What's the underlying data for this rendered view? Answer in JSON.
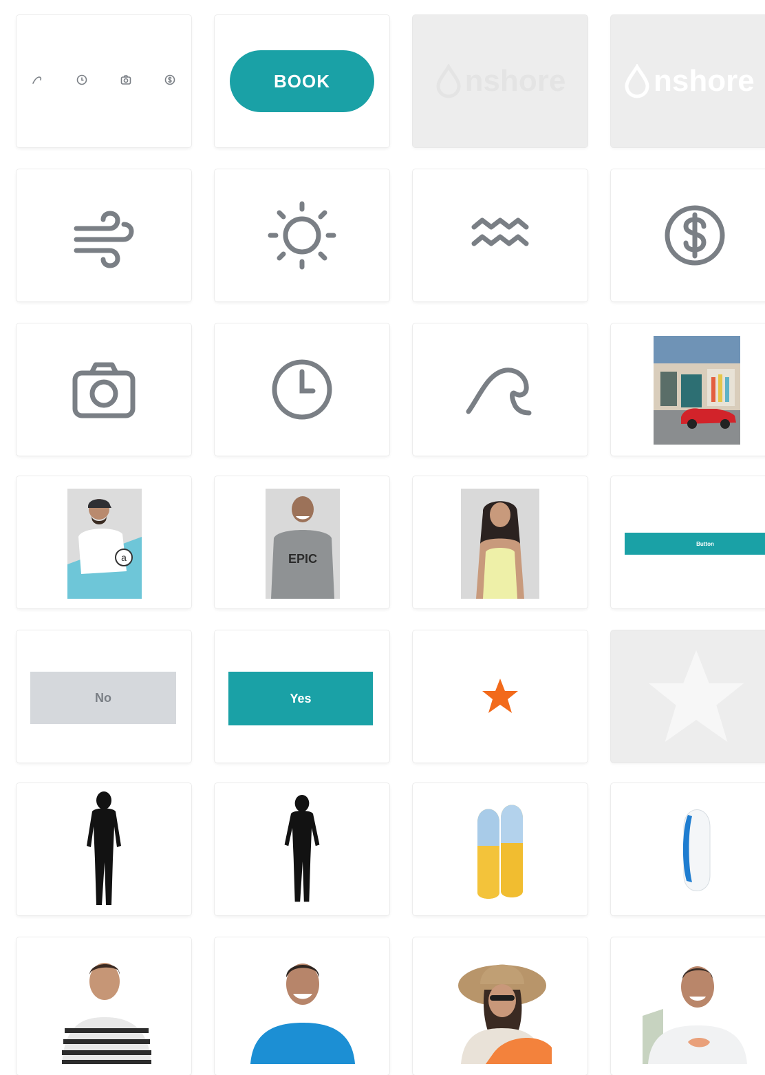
{
  "colors": {
    "brand_teal": "#1aa1a6",
    "icon_grey": "#7a7f85",
    "star_orange": "#f26a1b",
    "disabled_grey": "#d5d8dc"
  },
  "row1": {
    "mini_icons": [
      "wave-icon",
      "clock-icon",
      "camera-icon",
      "dollar-icon"
    ],
    "book_button": "BOOK",
    "logo_faded": "nshore",
    "logo_white": "nshore"
  },
  "row2": {
    "icons": [
      "wind-icon",
      "sun-icon",
      "water-icon",
      "dollar-circle-icon"
    ]
  },
  "row3": {
    "icons": [
      "camera-icon",
      "clock-icon",
      "wave-icon"
    ],
    "photo": "surf-shop-photo"
  },
  "row4": {
    "photos": [
      "instructor-photo-1",
      "instructor-photo-2",
      "instructor-photo-3"
    ],
    "tshirt_text": "EPIC",
    "bar_button": "Button"
  },
  "row5": {
    "no_button": "No",
    "yes_button": "Yes",
    "icons": [
      "star-icon",
      "star-outline-icon"
    ]
  },
  "row6": {
    "products": [
      "wetsuit-image",
      "wetsuit-image",
      "surfboards-image",
      "surfboard-image"
    ]
  },
  "row7": {
    "people": [
      "person-photo-1",
      "person-photo-2",
      "person-photo-3",
      "person-photo-4"
    ]
  }
}
